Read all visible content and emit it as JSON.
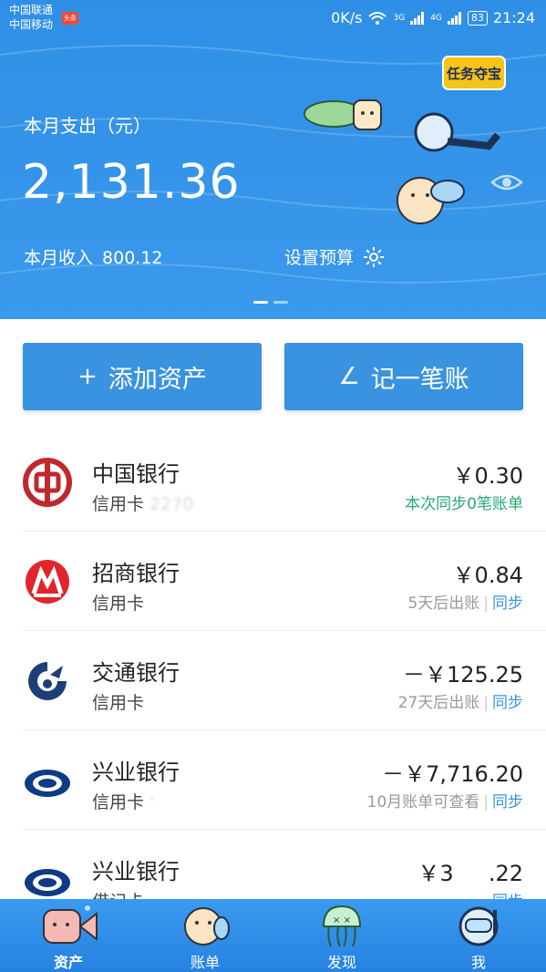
{
  "status_bar": {
    "carrier_line1": "中国联通",
    "carrier_line2": "中国移动",
    "carrier_badge": "头条",
    "speed": "0K/s",
    "signal_3g": "3G",
    "signal_4g": "4G",
    "battery": "83",
    "time": "21:24"
  },
  "hero": {
    "month_label": "本月支出（元）",
    "expense_amount": "2,131.36",
    "income_label": "本月收入",
    "income_amount": "800.12",
    "budget_label": "设置预算",
    "task_badge_text": "任务夺宝",
    "page_count": 2,
    "active_page": 1,
    "background_color": "#2f8fe6"
  },
  "actions": {
    "add_asset_icon": "+",
    "add_asset_label": "添加资产",
    "record_icon": "∠",
    "record_label": "记一笔账"
  },
  "accounts": [
    {
      "bank": "中国银行",
      "type": "信用卡",
      "masked_suffix": "2270",
      "amount": "￥0.30",
      "sub_text": "本次同步0笔账单",
      "sub_style": "green",
      "sync_label": "",
      "logo": "boc-logo-icon"
    },
    {
      "bank": "招商银行",
      "type": "信用卡",
      "masked_suffix": "",
      "amount": "￥0.84",
      "sub_text": "5天后出账",
      "sub_style": "gray",
      "sync_label": "同步",
      "logo": "cmb-logo-icon"
    },
    {
      "bank": "交通银行",
      "type": "信用卡",
      "masked_suffix": "",
      "amount": "－￥125.25",
      "sub_text": "27天后出账",
      "sub_style": "gray",
      "sync_label": "同步",
      "logo": "bocom-logo-icon"
    },
    {
      "bank": "兴业银行",
      "type": "信用卡",
      "masked_suffix": "'",
      "amount": "－￥7,716.20",
      "sub_text": "10月账单可查看",
      "sub_style": "gray",
      "sync_label": "同步",
      "logo": "cib-logo-icon"
    },
    {
      "bank": "兴业银行",
      "type": "借记卡",
      "masked_suffix": "",
      "amount": "￥3",
      "amount_tail": ".22",
      "sub_text": "",
      "sub_style": "gray",
      "sync_label": "同步",
      "logo": "cib-logo-icon"
    }
  ],
  "bottom_nav": [
    {
      "label": "资产",
      "icon": "fish-mascot-icon",
      "active": true
    },
    {
      "label": "账单",
      "icon": "pufferfish-mascot-icon",
      "active": false
    },
    {
      "label": "发现",
      "icon": "jellyfish-mascot-icon",
      "active": false
    },
    {
      "label": "我",
      "icon": "diver-mascot-icon",
      "active": false
    }
  ],
  "colors": {
    "accent": "#3a93e0",
    "green": "#25a874",
    "boc_red": "#c0282d",
    "cmb_red": "#e0262a",
    "bocom_navy": "#1c3f75",
    "cib_navy": "#0e3a86"
  }
}
